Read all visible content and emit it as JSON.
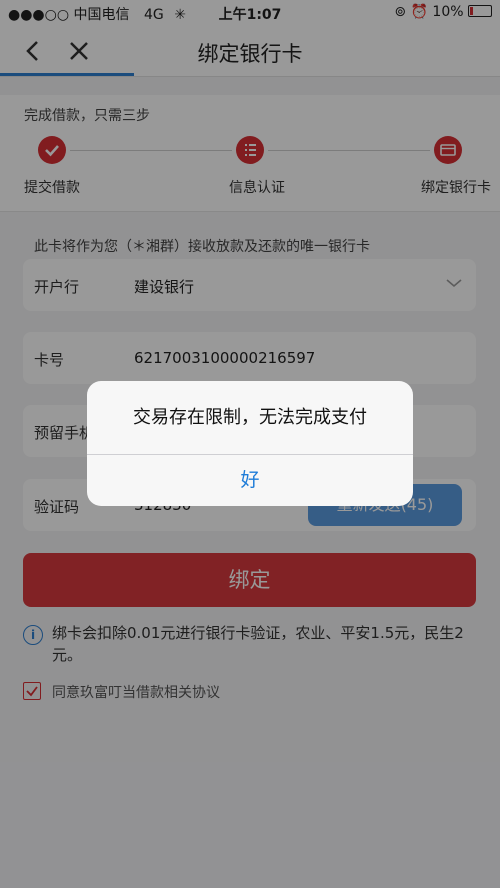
{
  "status_bar": {
    "signal": "●●●○○",
    "carrier": "中国电信",
    "network": "4G",
    "time": "上午1:07",
    "battery": "10%"
  },
  "nav": {
    "title": "绑定银行卡"
  },
  "steps": {
    "caption": "完成借款，只需三步",
    "items": [
      {
        "label": "提交借款",
        "icon": "check-icon"
      },
      {
        "label": "信息认证",
        "icon": "list-icon"
      },
      {
        "label": "绑定银行卡",
        "icon": "card-icon"
      }
    ]
  },
  "form": {
    "note": "此卡将作为您（＊湘群）接收放款及还款的唯一银行卡",
    "bank_label": "开户行",
    "bank_value": "建设银行",
    "card_label": "卡号",
    "card_value": "6217003100000216597",
    "phone_label": "预留手机",
    "code_label": "验证码",
    "code_value": "312830",
    "resend_label": "重新发送(45)"
  },
  "bind_button": "绑定",
  "info": {
    "text": "绑卡会扣除0.01元进行银行卡验证，农业、平安1.5元，民生2元。"
  },
  "agreement": {
    "text": "同意玖富叮当借款相关协议",
    "checked": true
  },
  "alert": {
    "message": "交易存在限制，无法完成支付",
    "ok_label": "好"
  },
  "colors": {
    "accent_red": "#d82f35",
    "accent_blue": "#2d7fd1"
  }
}
